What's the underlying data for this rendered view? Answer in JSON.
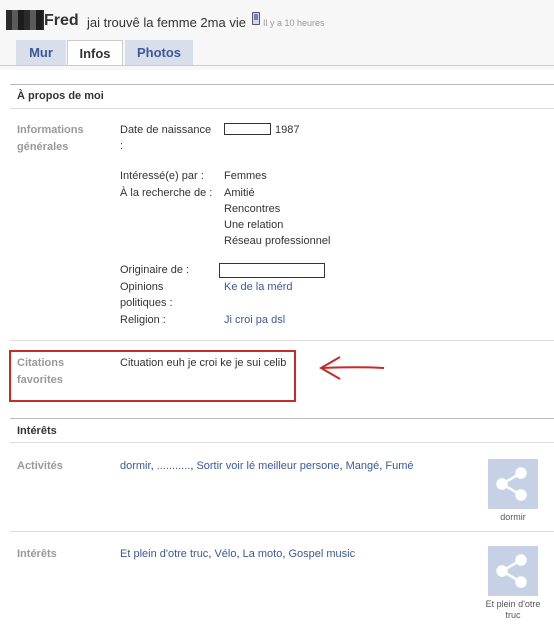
{
  "header": {
    "name": "Fred",
    "status": "jai trouvê la femme 2ma vie",
    "time": "Il y a 10 heures"
  },
  "tabs": [
    {
      "label": "Mur",
      "active": false
    },
    {
      "label": "Infos",
      "active": true
    },
    {
      "label": "Photos",
      "active": false
    }
  ],
  "about": {
    "title": "À propos de moi",
    "general_label": "Informations générales",
    "birth_label": "Date de naissance :",
    "birth_year": "1987",
    "interested_label": "Intéressé(e) par :",
    "interested_value": "Femmes",
    "looking_label": "À la recherche de :",
    "looking_values": [
      "Amitié",
      "Rencontres",
      "Une relation",
      "Réseau professionnel"
    ],
    "hometown_label": "Originaire de :",
    "political_label": "Opinions politiques :",
    "political_value": "Ke de la mérd",
    "religion_label": "Religion :",
    "religion_value": "Ji croi pa dsl"
  },
  "quotes": {
    "label": "Citations favorites",
    "value": "Cituation euh je croi ke je sui celib"
  },
  "interests": {
    "title": "Intérêts",
    "activities_label": "Activités",
    "activities": [
      "dormir",
      "...........",
      "Sortir voir lé meilleur persone",
      "Mangé",
      "Fumé"
    ],
    "activities_thumb": "dormir",
    "interests_label": "Intérêts",
    "interests_list": [
      "Et plein d'otre truc",
      "Vélo",
      "La moto",
      "Gospel music"
    ],
    "interests_thumb": "Et plein d'otre truc"
  },
  "colors": {
    "accent": "#3b5998",
    "highlight": "#c8292b"
  },
  "icons": {
    "phone": "mobile-phone-icon",
    "thumb": "share-network-icon",
    "arrow": "arrow-left-icon"
  }
}
